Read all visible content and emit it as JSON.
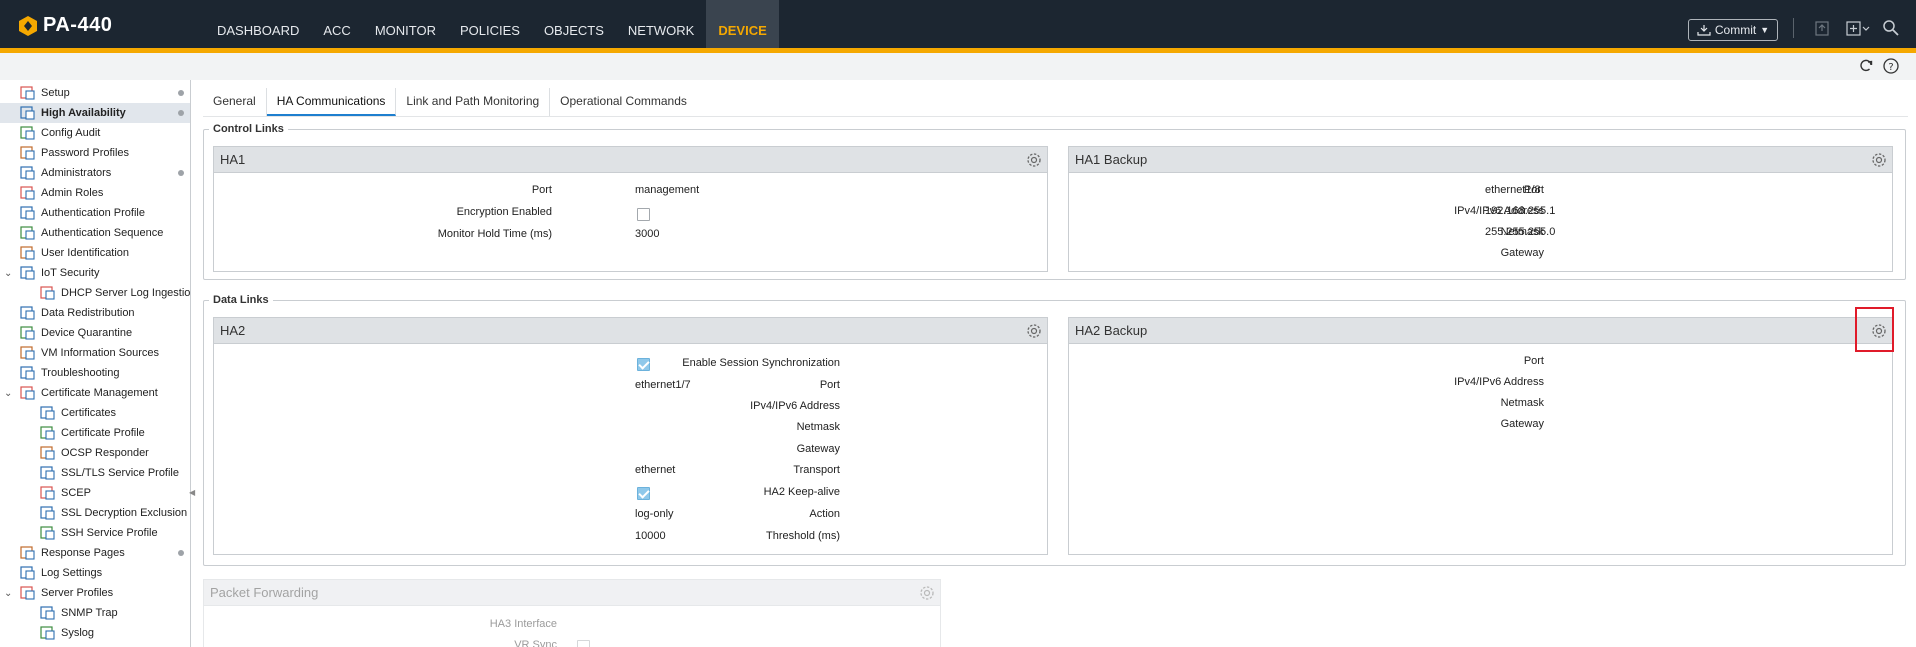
{
  "app": {
    "title": "PA-440"
  },
  "nav": {
    "items": [
      {
        "label": "DASHBOARD"
      },
      {
        "label": "ACC"
      },
      {
        "label": "MONITOR"
      },
      {
        "label": "POLICIES"
      },
      {
        "label": "OBJECTS"
      },
      {
        "label": "NETWORK"
      },
      {
        "label": "DEVICE"
      }
    ],
    "active": "DEVICE",
    "commit_label": "Commit"
  },
  "colors": {
    "topbar": "#1c2631",
    "accent": "#f5a800",
    "selection": "#e1e6ec",
    "link_tab": "#1e7fcf",
    "highlight": "#e01b2a"
  },
  "sidebar": {
    "items": [
      {
        "label": "Setup",
        "dot": true
      },
      {
        "label": "High Availability",
        "dot": true,
        "selected": true
      },
      {
        "label": "Config Audit"
      },
      {
        "label": "Password Profiles"
      },
      {
        "label": "Administrators",
        "dot": true
      },
      {
        "label": "Admin Roles"
      },
      {
        "label": "Authentication Profile"
      },
      {
        "label": "Authentication Sequence"
      },
      {
        "label": "User Identification"
      },
      {
        "label": "IoT Security",
        "expanded": true
      },
      {
        "label": "DHCP Server Log Ingestion",
        "child": true
      },
      {
        "label": "Data Redistribution"
      },
      {
        "label": "Device Quarantine"
      },
      {
        "label": "VM Information Sources"
      },
      {
        "label": "Troubleshooting"
      },
      {
        "label": "Certificate Management",
        "expanded": true
      },
      {
        "label": "Certificates",
        "child": true
      },
      {
        "label": "Certificate Profile",
        "child": true
      },
      {
        "label": "OCSP Responder",
        "child": true
      },
      {
        "label": "SSL/TLS Service Profile",
        "child": true
      },
      {
        "label": "SCEP",
        "child": true
      },
      {
        "label": "SSL Decryption Exclusion",
        "child": true
      },
      {
        "label": "SSH Service Profile",
        "child": true
      },
      {
        "label": "Response Pages",
        "dot": true
      },
      {
        "label": "Log Settings"
      },
      {
        "label": "Server Profiles",
        "expanded": true
      },
      {
        "label": "SNMP Trap",
        "child": true
      },
      {
        "label": "Syslog",
        "child": true
      }
    ]
  },
  "tabs": [
    {
      "label": "General"
    },
    {
      "label": "HA Communications",
      "active": true
    },
    {
      "label": "Link and Path Monitoring"
    },
    {
      "label": "Operational Commands"
    }
  ],
  "control_links": {
    "title": "Control Links",
    "ha1": {
      "title": "HA1",
      "port_label": "Port",
      "port_value": "management",
      "encryption_label": "Encryption Enabled",
      "encryption_checked": false,
      "hold_label": "Monitor Hold Time (ms)",
      "hold_value": "3000"
    },
    "ha1_backup": {
      "title": "HA1 Backup",
      "port_label": "Port",
      "port_value": "ethernet1/8",
      "ip_label": "IPv4/IPv6 Address",
      "ip_value": "192.168.255.1",
      "netmask_label": "Netmask",
      "netmask_value": "255.255.255.0",
      "gateway_label": "Gateway",
      "gateway_value": ""
    }
  },
  "data_links": {
    "title": "Data Links",
    "ha2": {
      "title": "HA2",
      "sync_label": "Enable Session Synchronization",
      "sync_checked": true,
      "port_label": "Port",
      "port_value": "ethernet1/7",
      "ip_label": "IPv4/IPv6 Address",
      "ip_value": "",
      "netmask_label": "Netmask",
      "netmask_value": "",
      "gateway_label": "Gateway",
      "gateway_value": "",
      "transport_label": "Transport",
      "transport_value": "ethernet",
      "keepalive_label": "HA2 Keep-alive",
      "keepalive_checked": true,
      "action_label": "Action",
      "action_value": "log-only",
      "threshold_label": "Threshold (ms)",
      "threshold_value": "10000"
    },
    "ha2_backup": {
      "title": "HA2 Backup",
      "port_label": "Port",
      "ip_label": "IPv4/IPv6 Address",
      "netmask_label": "Netmask",
      "gateway_label": "Gateway"
    }
  },
  "packet_forwarding": {
    "title": "Packet Forwarding",
    "ha3_label": "HA3 Interface",
    "vr_sync_label": "VR Sync"
  }
}
